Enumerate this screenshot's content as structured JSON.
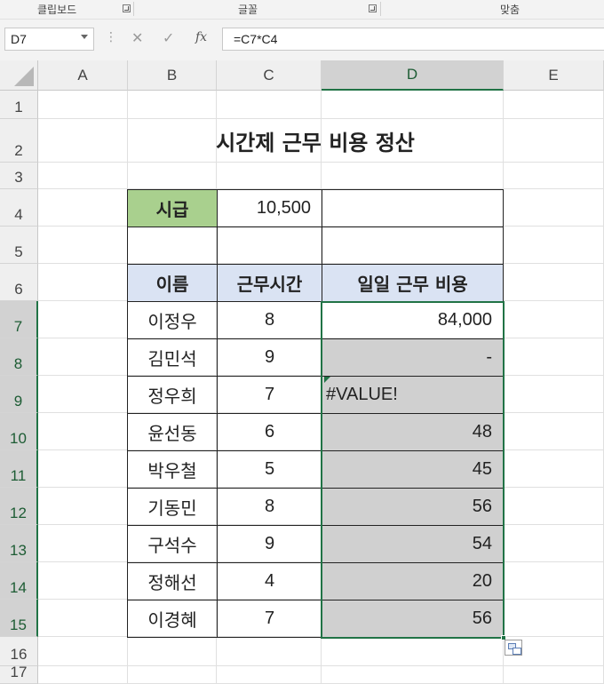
{
  "ribbon": {
    "groups": [
      "클립보드",
      "글꼴",
      "맞춤"
    ]
  },
  "formula_bar": {
    "name_box": "D7",
    "formula": "=C7*C4",
    "fx_label": "fx",
    "cancel_icon": "✕",
    "enter_icon": "✓"
  },
  "columns": [
    "A",
    "B",
    "C",
    "D",
    "E"
  ],
  "rows": [
    "1",
    "2",
    "3",
    "4",
    "5",
    "6",
    "7",
    "8",
    "9",
    "10",
    "11",
    "12",
    "13",
    "14",
    "15",
    "16",
    "17"
  ],
  "sheet": {
    "title": "시간제 근무 비용 정산",
    "wage_label": "시급",
    "wage_value": "10,500",
    "headers": [
      "이름",
      "근무시간",
      "일일 근무 비용"
    ],
    "records": [
      {
        "name": "이정우",
        "hours": "8",
        "cost": "84,000"
      },
      {
        "name": "김민석",
        "hours": "9",
        "cost": "-"
      },
      {
        "name": "정우희",
        "hours": "7",
        "cost": "#VALUE!"
      },
      {
        "name": "윤선동",
        "hours": "6",
        "cost": "48"
      },
      {
        "name": "박우철",
        "hours": "5",
        "cost": "45"
      },
      {
        "name": "기동민",
        "hours": "8",
        "cost": "56"
      },
      {
        "name": "구석수",
        "hours": "9",
        "cost": "54"
      },
      {
        "name": "정해선",
        "hours": "4",
        "cost": "20"
      },
      {
        "name": "이경혜",
        "hours": "7",
        "cost": "56"
      }
    ]
  },
  "colors": {
    "accent": "#217346",
    "wage_fill": "#a9d08e",
    "header_fill": "#dae3f3",
    "selection_fill": "#d0d0d0"
  }
}
